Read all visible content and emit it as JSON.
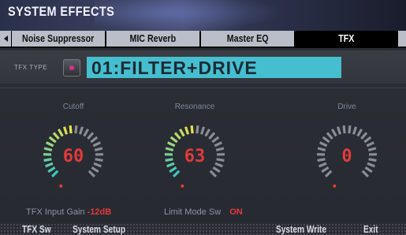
{
  "window": {
    "title": "SYSTEM EFFECTS"
  },
  "tabs": [
    {
      "label": "Noise Suppressor",
      "active": false
    },
    {
      "label": "MIC Reverb",
      "active": false
    },
    {
      "label": "Master EQ",
      "active": false
    },
    {
      "label": "TFX",
      "active": true
    }
  ],
  "tfx_type": {
    "label": "TFX TYPE",
    "value": "01:FILTER+DRIVE"
  },
  "knobs": [
    {
      "label": "Cutoff",
      "value": "60",
      "level": 0.48
    },
    {
      "label": "Resonance",
      "value": "63",
      "level": 0.5
    },
    {
      "label": "Drive",
      "value": "0",
      "level": 0.0
    }
  ],
  "params": {
    "input_gain_label": "TFX Input Gain",
    "input_gain_value": "-12dB",
    "limit_label": "Limit Mode Sw",
    "limit_value": "ON"
  },
  "footer": {
    "tfx_sw": "TFX Sw",
    "system_setup": "System Setup",
    "system_write": "System Write",
    "exit": "Exit"
  },
  "colors": {
    "type_box": "#45bfd0",
    "value_red": "#e33a3a",
    "arc_yellow": "#e8e04a",
    "arc_cyan": "#3cc6c0",
    "arc_grey": "#8a8d93"
  }
}
